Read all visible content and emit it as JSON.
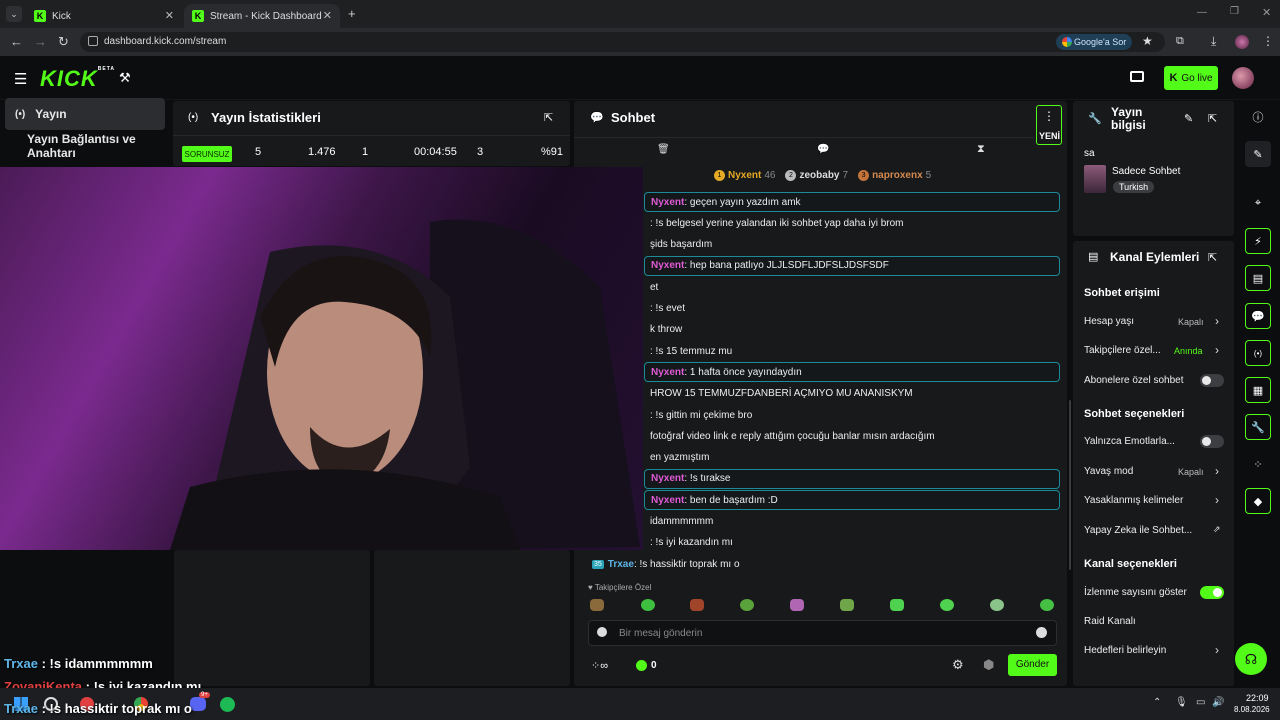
{
  "browser": {
    "tabs": [
      {
        "title": "Kick"
      },
      {
        "title": "Stream - Kick Dashboard"
      }
    ],
    "url": "dashboard.kick.com/stream",
    "google_chip": "Google'a Sor",
    "new_tab": "+"
  },
  "app": {
    "logo": "KICK",
    "logo_badge": "BETA",
    "go_live": "Go live"
  },
  "leftnav": {
    "items": [
      {
        "label": "Yayın"
      },
      {
        "label": "Yayın Bağlantısı ve Anahtarı"
      }
    ]
  },
  "stats": {
    "title": "Yayın İstatistikleri",
    "status": "SORUNSUZ",
    "values": [
      "5",
      "1.476",
      "1",
      "00:04:55",
      "3",
      "%91"
    ]
  },
  "chat": {
    "title": "Sohbet",
    "new_badge": "YENİ",
    "top_chatters": [
      {
        "rank": "1",
        "name": "Nyxent",
        "count": "46"
      },
      {
        "rank": "2",
        "name": "zeobaby",
        "count": "7"
      },
      {
        "rank": "3",
        "name": "naproxenx",
        "count": "5"
      }
    ],
    "messages": [
      {
        "user": "Nyxent",
        "text": ": geçen yayın yazdım amk",
        "highlight": true
      },
      {
        "user": "",
        "text": ": !s belgesel yerine yalandan iki sohbet yap daha iyi brom",
        "highlight": false
      },
      {
        "user": "",
        "text": "şids başardım",
        "highlight": false
      },
      {
        "user": "Nyxent",
        "text": ": hep bana patlıyo JLJLSDFLJDFSLJDSFSDF",
        "highlight": true
      },
      {
        "user": "",
        "text": "et",
        "highlight": false
      },
      {
        "user": "",
        "text": ": !s evet",
        "highlight": false
      },
      {
        "user": "",
        "text": "k throw",
        "highlight": false
      },
      {
        "user": "",
        "text": ": !s 15 temmuz mu",
        "highlight": false
      },
      {
        "user": "Nyxent",
        "text": ": 1 hafta önce yayındaydın",
        "highlight": true
      },
      {
        "user": "",
        "text": "HROW 15 TEMMUZFDANBERİ AÇMIYO MU ANANISKYM",
        "highlight": false
      },
      {
        "user": "",
        "text": ": !s gittin mi çekime bro",
        "highlight": false
      },
      {
        "user": "",
        "text": "fotoğraf video link e reply attığım çocuğu banlar mısın ardacığım",
        "highlight": false
      },
      {
        "user": "",
        "text": "en yazmıştım",
        "highlight": false
      },
      {
        "user": "Nyxent",
        "text": ": !s tırakse",
        "highlight": true
      },
      {
        "user": "Nyxent",
        "text": ": ben de başardım :D",
        "highlight": true
      },
      {
        "user": "",
        "text": "idammmmmm",
        "highlight": false
      },
      {
        "user": "",
        "text": ": !s iyi kazandın mı",
        "highlight": false
      }
    ],
    "last_message": {
      "badge": "35",
      "user": "Trxae",
      "text": ": !s hassiktir toprak mı o"
    },
    "followers_only": "Takipçilere Özel",
    "input_placeholder": "Bir mesaj gönderin",
    "points": "0",
    "send": "Gönder"
  },
  "overlay_chat": [
    {
      "user": "Trxae",
      "text": " : !s idammmmmm",
      "color": "#5fb6e8"
    },
    {
      "user": "ZovaniKenta",
      "text": " : !s iyi kazandın mı",
      "color": "#e04040"
    },
    {
      "user": "Trxae",
      "text": " : !s hassiktir toprak mı o",
      "color": "#5fb6e8"
    }
  ],
  "stream_info": {
    "title": "Yayın bilgisi",
    "stream_title": "sa",
    "category": "Sadece Sohbet",
    "language": "Turkish"
  },
  "channel_actions": {
    "title": "Kanal Eylemleri",
    "chat_access": "Sohbet erişimi",
    "account_age": {
      "label": "Hesap yaşı",
      "value": "Kapalı"
    },
    "followers_only": {
      "label": "Takipçilere özel...",
      "value": "Anında"
    },
    "subscribers_only": {
      "label": "Abonelere özel sohbet"
    },
    "chat_options": "Sohbet seçenekleri",
    "emotes_only": {
      "label": "Yalnızca Emotlarla..."
    },
    "slow_mode": {
      "label": "Yavaş mod",
      "value": "Kapalı"
    },
    "banned_words": {
      "label": "Yasaklanmış kelimeler"
    },
    "ai_chat": {
      "label": "Yapay Zeka ile Sohbet..."
    },
    "channel_options": "Kanal seçenekleri",
    "show_viewers": {
      "label": "İzlenme sayısını göster"
    },
    "raid": {
      "label": "Raid Kanalı"
    },
    "goals": {
      "label": "Hedefleri belirleyin"
    }
  },
  "taskbar": {
    "time": "22:09",
    "date": "8.08.2026",
    "discord_badge": "9+"
  },
  "colors": {
    "accent": "#53fc18",
    "panel": "#18191b",
    "bg": "#0b0d0e"
  }
}
